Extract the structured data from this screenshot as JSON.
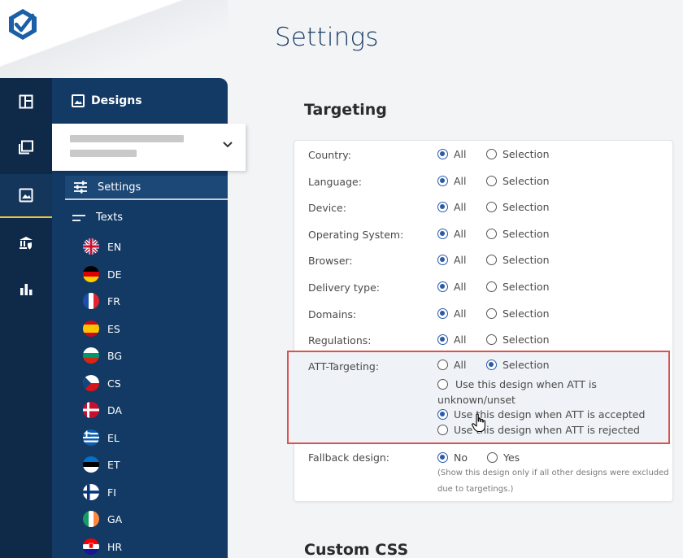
{
  "page_title": "Settings",
  "sidebar": {
    "header": "Designs",
    "settings_label": "Settings",
    "texts_label": "Texts",
    "languages": [
      "EN",
      "DE",
      "FR",
      "ES",
      "BG",
      "CS",
      "DA",
      "EL",
      "ET",
      "FI",
      "GA",
      "HR"
    ]
  },
  "targeting": {
    "title": "Targeting",
    "opt_all": "All",
    "opt_selection": "Selection",
    "rows": [
      {
        "label": "Country:"
      },
      {
        "label": "Language:"
      },
      {
        "label": "Device:"
      },
      {
        "label": "Operating System:"
      },
      {
        "label": "Browser:"
      },
      {
        "label": "Delivery type:"
      },
      {
        "label": "Domains:"
      },
      {
        "label": "Regulations:"
      }
    ],
    "att": {
      "label": "ATT-Targeting:",
      "all": "All",
      "selection": "Selection",
      "opt_unknown_line1": "Use this design when ATT is",
      "opt_unknown_line2": "unknown/unset",
      "opt_accepted": "Use this design when ATT is accepted",
      "opt_rejected": "Use this design when ATT is rejected"
    },
    "fallback": {
      "label": "Fallback design:",
      "no": "No",
      "yes": "Yes",
      "note_line1": "(Show this design only if all other designs were excluded",
      "note_line2": "due to targetings.)"
    }
  },
  "custom_css": {
    "title": "Custom CSS"
  },
  "colors": {
    "rail": "#0f2a48",
    "nav": "#123a64",
    "accent": "#2a5aa8",
    "highlight_border": "#d9534f",
    "title": "#1d3f66"
  }
}
